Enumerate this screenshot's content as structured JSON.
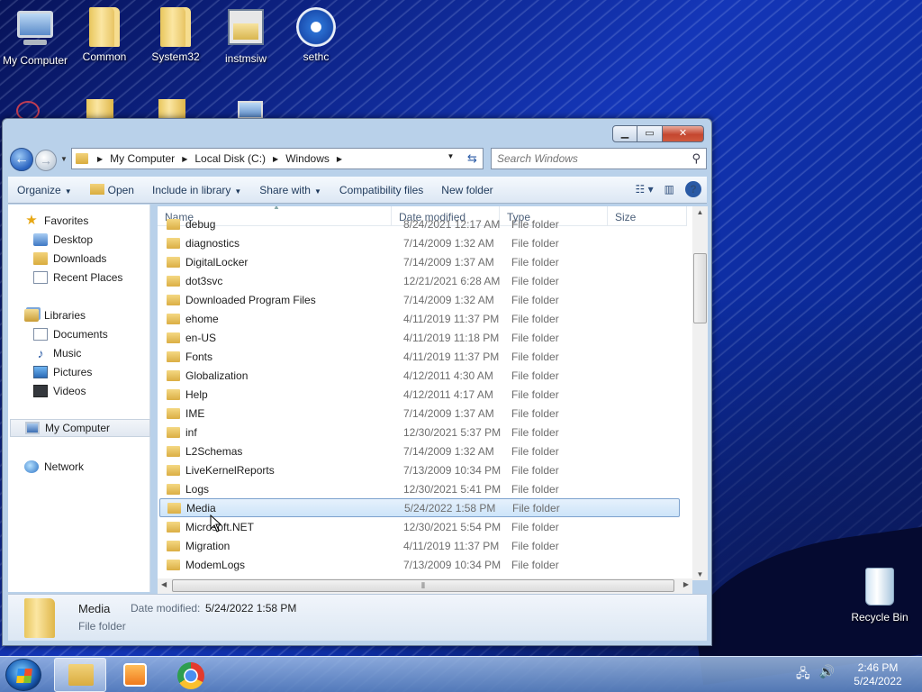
{
  "desktop": {
    "icons": [
      {
        "label": "My Computer"
      },
      {
        "label": "Common"
      },
      {
        "label": "System32"
      },
      {
        "label": "instmsiw"
      },
      {
        "label": "sethc"
      }
    ],
    "recycle_bin": "Recycle Bin"
  },
  "explorer": {
    "address": {
      "crumbs": [
        "My Computer",
        "Local Disk (C:)",
        "Windows"
      ]
    },
    "search": {
      "placeholder": "Search Windows"
    },
    "toolbar": {
      "organize": "Organize",
      "open": "Open",
      "include_in_library": "Include in library",
      "share_with": "Share with",
      "compatibility_files": "Compatibility files",
      "new_folder": "New folder"
    },
    "nav": {
      "favorites": "Favorites",
      "desktop": "Desktop",
      "downloads": "Downloads",
      "recent_places": "Recent Places",
      "libraries": "Libraries",
      "documents": "Documents",
      "music": "Music",
      "pictures": "Pictures",
      "videos": "Videos",
      "my_computer": "My Computer",
      "network": "Network"
    },
    "columns": {
      "name": "Name",
      "date_modified": "Date modified",
      "type": "Type",
      "size": "Size"
    },
    "rows": [
      {
        "name": "debug",
        "date": "8/24/2021 12:17 AM",
        "type": "File folder"
      },
      {
        "name": "diagnostics",
        "date": "7/14/2009 1:32 AM",
        "type": "File folder"
      },
      {
        "name": "DigitalLocker",
        "date": "7/14/2009 1:37 AM",
        "type": "File folder"
      },
      {
        "name": "dot3svc",
        "date": "12/21/2021 6:28 AM",
        "type": "File folder"
      },
      {
        "name": "Downloaded Program Files",
        "date": "7/14/2009 1:32 AM",
        "type": "File folder"
      },
      {
        "name": "ehome",
        "date": "4/11/2019 11:37 PM",
        "type": "File folder"
      },
      {
        "name": "en-US",
        "date": "4/11/2019 11:18 PM",
        "type": "File folder"
      },
      {
        "name": "Fonts",
        "date": "4/11/2019 11:37 PM",
        "type": "File folder"
      },
      {
        "name": "Globalization",
        "date": "4/12/2011 4:30 AM",
        "type": "File folder"
      },
      {
        "name": "Help",
        "date": "4/12/2011 4:17 AM",
        "type": "File folder"
      },
      {
        "name": "IME",
        "date": "7/14/2009 1:37 AM",
        "type": "File folder"
      },
      {
        "name": "inf",
        "date": "12/30/2021 5:37 PM",
        "type": "File folder"
      },
      {
        "name": "L2Schemas",
        "date": "7/14/2009 1:32 AM",
        "type": "File folder"
      },
      {
        "name": "LiveKernelReports",
        "date": "7/13/2009 10:34 PM",
        "type": "File folder"
      },
      {
        "name": "Logs",
        "date": "12/30/2021 5:41 PM",
        "type": "File folder"
      },
      {
        "name": "Media",
        "date": "5/24/2022 1:58 PM",
        "type": "File folder"
      },
      {
        "name": "Microsoft.NET",
        "date": "12/30/2021 5:54 PM",
        "type": "File folder"
      },
      {
        "name": "Migration",
        "date": "4/11/2019 11:37 PM",
        "type": "File folder"
      },
      {
        "name": "ModemLogs",
        "date": "7/13/2009 10:34 PM",
        "type": "File folder"
      }
    ],
    "selected_index": 15,
    "details": {
      "name": "Media",
      "type": "File folder",
      "date_label": "Date modified:",
      "date_value": "5/24/2022 1:58 PM"
    }
  },
  "taskbar": {
    "time": "2:46 PM",
    "date": "5/24/2022"
  }
}
